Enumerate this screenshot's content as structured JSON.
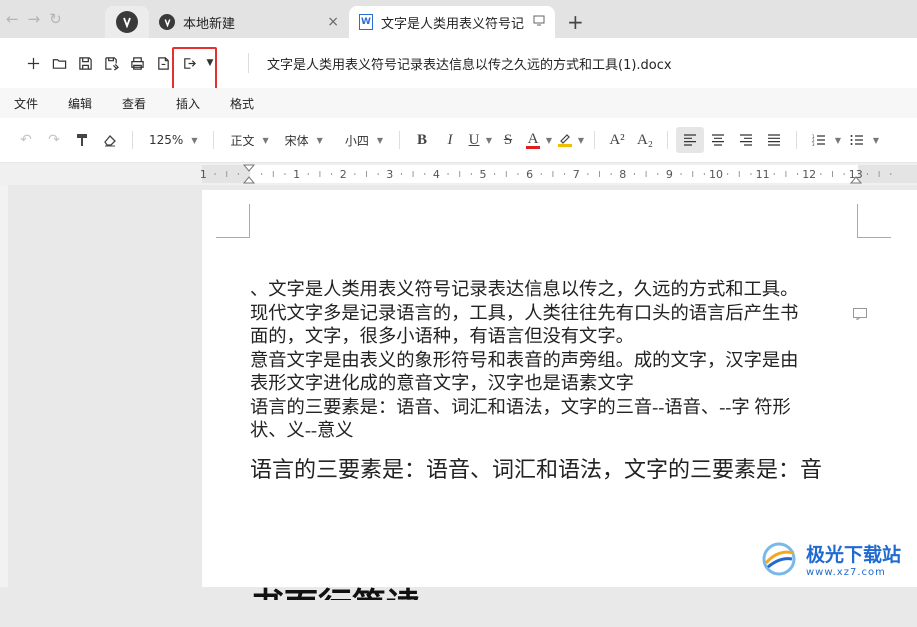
{
  "tabs": {
    "items": [
      {
        "label": "本地新建",
        "close": "×"
      },
      {
        "label": "文字是人类用表义符号记"
      }
    ],
    "add_label": "+"
  },
  "file_toolbar": {
    "document_name": "文字是人类用表义符号记录表达信息以传之久远的方式和工具(1).docx",
    "highlight_color": "#e53030"
  },
  "menu": {
    "items": [
      "文件",
      "编辑",
      "查看",
      "插入",
      "格式"
    ]
  },
  "format_toolbar": {
    "zoom": "125%",
    "style": "正文",
    "font": "宋体",
    "size": "小四",
    "bold": "B",
    "italic": "I",
    "underline": "U",
    "strike": "S",
    "font_color": "A",
    "superscript": "A²",
    "subscript": "A₂",
    "font_color_swatch": "#e02020",
    "highlight_swatch": "#f0c000"
  },
  "ruler": {
    "labels": [
      "1",
      "1",
      "2",
      "3",
      "4",
      "5",
      "6",
      "7",
      "8",
      "9",
      "10",
      "11",
      "12",
      "13"
    ]
  },
  "document": {
    "paragraphs": [
      "、文字是人类用表义符号记录表达信息以传之，久远的方式和工具。",
      "现代文字多是记录语言的，工具，人类往往先有口头的语言后产生书",
      "面的，文字，很多小语种，有语言但没有文字。",
      "意音文字是由表义的象形符号和表音的声旁组。成的文字，汉字是由",
      "表形文字进化成的意音文字，汉字也是语素文字",
      "语言的三要素是：语音、词汇和语法，文字的三音--语音、--字  符形",
      "状、义--意义"
    ],
    "large_paragraph": "语言的三要素是：语音、词汇和语法，文字的三要素是：音",
    "heading_partial": "书面行篇读"
  },
  "watermark": {
    "name": "极光下载站",
    "url": "www.xz7.com"
  }
}
